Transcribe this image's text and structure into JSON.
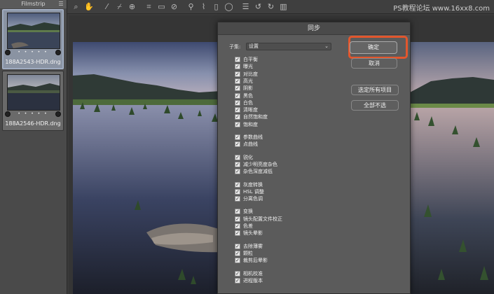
{
  "filmstrip": {
    "title": "Filmstrip",
    "menu_icon": "list-icon",
    "items": [
      {
        "name": "188A2543-HDR.dng",
        "stars": "• • • • •",
        "selected": true
      },
      {
        "name": "188A2546-HDR.dng",
        "stars": "• • • • •",
        "selected": false
      }
    ]
  },
  "toolbar": {
    "icons": [
      "zoom-icon",
      "hand-icon",
      "white-balance-icon",
      "color-sampler-icon",
      "target-adjust-icon",
      "crop-icon",
      "straighten-icon",
      "spot-removal-icon",
      "red-eye-icon",
      "adjustment-brush-icon",
      "graduated-filter-icon",
      "radial-filter-icon",
      "preferences-icon",
      "rotate-left-icon",
      "rotate-right-icon",
      "trash-icon"
    ],
    "watermark": "PS教程论坛 www.16xx8.com"
  },
  "dialog": {
    "title": "同步",
    "subset_label": "子集:",
    "subset_value": "设置",
    "options": [
      {
        "label": "白平衡",
        "checked": true
      },
      {
        "label": "曝光",
        "checked": true
      },
      {
        "label": "对比度",
        "checked": true
      },
      {
        "label": "高光",
        "checked": true
      },
      {
        "label": "阴影",
        "checked": true
      },
      {
        "label": "黑色",
        "checked": true
      },
      {
        "label": "白色",
        "checked": true
      },
      {
        "label": "清晰度",
        "checked": true
      },
      {
        "label": "自然饱和度",
        "checked": true
      },
      {
        "label": "饱和度",
        "checked": true
      },
      {
        "label": "参数曲线",
        "checked": true
      },
      {
        "label": "点曲线",
        "checked": true
      },
      {
        "label": "锐化",
        "checked": true
      },
      {
        "label": "减少明亮度杂色",
        "checked": true
      },
      {
        "label": "杂色深度减低",
        "checked": true
      },
      {
        "label": "灰度转换",
        "checked": true
      },
      {
        "label": "HSL 调整",
        "checked": true
      },
      {
        "label": "分离色调",
        "checked": true
      },
      {
        "label": "变换",
        "checked": true
      },
      {
        "label": "镜头配置文件校正",
        "checked": true
      },
      {
        "label": "色差",
        "checked": true
      },
      {
        "label": "镜头晕影",
        "checked": true
      },
      {
        "label": "去除薄雾",
        "checked": true
      },
      {
        "label": "颗粒",
        "checked": true
      },
      {
        "label": "裁剪后晕影",
        "checked": true
      },
      {
        "label": "相机校准",
        "checked": true
      },
      {
        "label": "进程版本",
        "checked": true
      }
    ],
    "buttons": {
      "ok": "确定",
      "cancel": "取消",
      "select_all": "选定所有项目",
      "select_none": "全部不选"
    },
    "highlight_color": "#e2562d"
  }
}
